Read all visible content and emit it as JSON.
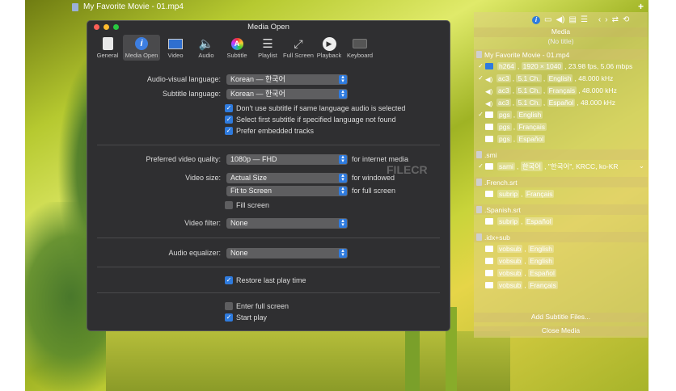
{
  "window_title": "My Favorite Movie - 01.mp4",
  "dialog": {
    "title": "Media Open",
    "tabs": [
      {
        "label": "General",
        "icon": "general-icon"
      },
      {
        "label": "Media Open",
        "icon": "info-icon"
      },
      {
        "label": "Video",
        "icon": "monitor-icon"
      },
      {
        "label": "Audio",
        "icon": "speaker-icon"
      },
      {
        "label": "Subtitle",
        "icon": "subtitle-icon"
      },
      {
        "label": "Playlist",
        "icon": "list-icon"
      },
      {
        "label": "Full Screen",
        "icon": "fullscreen-icon"
      },
      {
        "label": "Playback",
        "icon": "play-icon"
      },
      {
        "label": "Keyboard",
        "icon": "keyboard-icon"
      }
    ],
    "av_language": {
      "label": "Audio-visual language:",
      "value": "Korean — 한국어"
    },
    "sub_language": {
      "label": "Subtitle language:",
      "value": "Korean — 한국어"
    },
    "checks": {
      "no_sub_same_audio": "Don't use subtitle if same language audio is selected",
      "first_sub": "Select first subtitle if specified language not found",
      "prefer_embedded": "Prefer embedded tracks",
      "fill_screen": "Fill screen",
      "restore": "Restore last play time",
      "enter_full": "Enter full screen",
      "start_play": "Start play"
    },
    "quality": {
      "label": "Preferred video quality:",
      "value": "1080p — FHD",
      "side": "for internet media"
    },
    "video_size": {
      "label": "Video size:",
      "windowed": "Actual Size",
      "windowed_side": "for windowed",
      "full": "Fit to Screen",
      "full_side": "for full screen"
    },
    "video_filter": {
      "label": "Video filter:",
      "value": "None"
    },
    "audio_eq": {
      "label": "Audio equalizer:",
      "value": "None"
    }
  },
  "watermark": "FILECR",
  "panel": {
    "header": "Media",
    "no_title": "(No title)",
    "file": "My Favorite Movie - 01.mp4",
    "video": [
      "h264",
      "1920 × 1040",
      "23.98 fps, 5.06 mbps"
    ],
    "audio": [
      [
        "ac3",
        "5.1 Ch.",
        "English",
        "48.000 kHz"
      ],
      [
        "ac3",
        "5.1 Ch.",
        "Français",
        "48.000 kHz"
      ],
      [
        "ac3",
        "5.1 Ch.",
        "Español",
        "48.000 kHz"
      ]
    ],
    "subs": [
      [
        "pgs",
        "English"
      ],
      [
        "pgs",
        "Français"
      ],
      [
        "pgs",
        "Español"
      ]
    ],
    "smi_label": ".smi",
    "smi": [
      "sami",
      "한국어",
      "\"한국어\", KRCC, ko-KR"
    ],
    "french_label": ".French.srt",
    "french": [
      "subrip",
      "Français"
    ],
    "spanish_label": ".Spanish.srt",
    "spanish": [
      "subrip",
      "Español"
    ],
    "idx_label": ".idx+sub",
    "idx": [
      [
        "vobsub",
        "English"
      ],
      [
        "vobsub",
        "English"
      ],
      [
        "vobsub",
        "Español"
      ],
      [
        "vobsub",
        "Français"
      ]
    ],
    "add_subs": "Add Subtitle Files...",
    "close": "Close Media"
  }
}
